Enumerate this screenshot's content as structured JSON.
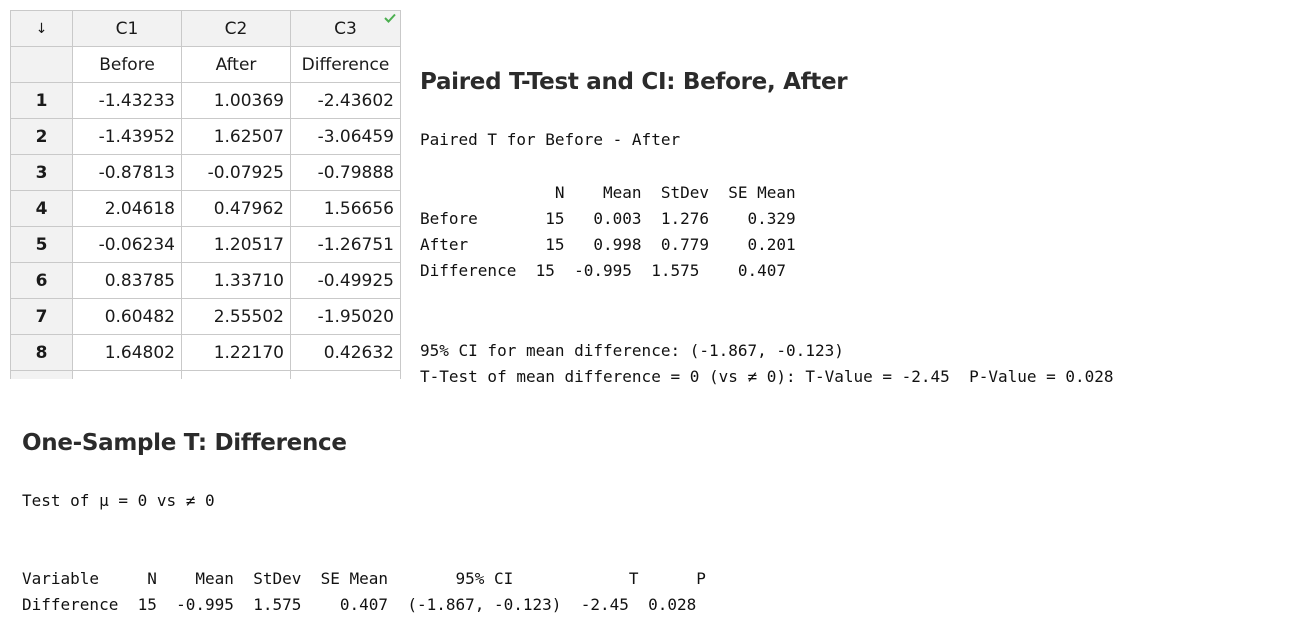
{
  "worksheet": {
    "sort_arrow": "↓",
    "column_ids": [
      "C1",
      "C2",
      "C3"
    ],
    "column_names": [
      "Before",
      "After",
      "Difference"
    ],
    "rows": [
      {
        "n": "1",
        "before": "-1.43233",
        "after": "1.00369",
        "diff": "-2.43602"
      },
      {
        "n": "2",
        "before": "-1.43952",
        "after": "1.62507",
        "diff": "-3.06459"
      },
      {
        "n": "3",
        "before": "-0.87813",
        "after": "-0.07925",
        "diff": "-0.79888"
      },
      {
        "n": "4",
        "before": "2.04618",
        "after": "0.47962",
        "diff": "1.56656"
      },
      {
        "n": "5",
        "before": "-0.06234",
        "after": "1.20517",
        "diff": "-1.26751"
      },
      {
        "n": "6",
        "before": "0.83785",
        "after": "1.33710",
        "diff": "-0.49925"
      },
      {
        "n": "7",
        "before": "0.60482",
        "after": "2.55502",
        "diff": "-1.95020"
      },
      {
        "n": "8",
        "before": "1.64802",
        "after": "1.22170",
        "diff": "0.42632"
      }
    ]
  },
  "paired": {
    "title": "Paired T-Test and CI: Before, After",
    "subtitle": "Paired T for Before - After",
    "table_header": "              N    Mean  StDev  SE Mean",
    "table_lines": [
      "Before       15   0.003  1.276    0.329",
      "After        15   0.998  0.779    0.201",
      "Difference  15  -0.995  1.575    0.407"
    ],
    "ci_line": "95% CI for mean difference: (-1.867, -0.123)",
    "ttest_line": "T-Test of mean difference = 0 (vs ≠ 0): T-Value = -2.45  P-Value = 0.028"
  },
  "one_sample": {
    "title": "One-Sample T: Difference",
    "test_line": "Test of μ = 0 vs ≠ 0",
    "header": "Variable     N    Mean  StDev  SE Mean       95% CI            T      P",
    "row": "Difference  15  -0.995  1.575    0.407  (-1.867, -0.123)  -2.45  0.028"
  }
}
